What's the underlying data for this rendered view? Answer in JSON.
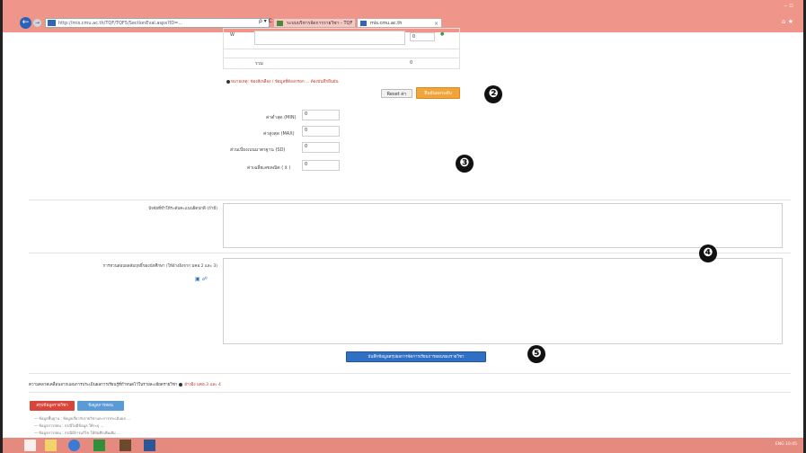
{
  "browser": {
    "url": "http://mis.cmu.ac.th/TQF/TQF5/SectionEval.aspx?ID=...",
    "tabs": [
      {
        "label": "ระบบบริหารจัดการรายวิชา - TQF",
        "active": false
      },
      {
        "label": "mis.cmu.ac.th",
        "active": true
      }
    ],
    "nav_tools": "ρ ▾ C",
    "window_controls": "– ▫",
    "window_tools": "⌂ ★"
  },
  "grade_table": {
    "row_w": {
      "grade": "W",
      "count": "0",
      "status": "●"
    },
    "total": {
      "label": "รวม",
      "count": "0"
    }
  },
  "note": "หมายเหตุ: ช่องสีเหลือง / ข้อมูลที่ต้องกรอก ... ต้องบันทึกยืนยัน",
  "buttons": {
    "reset": "Reset ค่า",
    "confirm": "ยืนยันผลระดับ",
    "save": "บันทึกข้อมูลสรุปผลการจัดการเรียนการสอนของรายวิชา",
    "tab_red": "สรุปข้อมูลรายวิชา",
    "tab_blue": "ข้อมูลการสอน"
  },
  "stats": [
    {
      "label": "ค่าต่ำสุด (MIN)",
      "value": "0"
    },
    {
      "label": "ค่าสูงสุด (MAX)",
      "value": "0"
    },
    {
      "label": "ส่วนเบี่ยงเบนมาตรฐาน (SD)",
      "value": "0"
    },
    {
      "label": "ค่าเฉลี่ยเลขคณิต ( x̄ )",
      "value": "0"
    }
  ],
  "textareas": {
    "factor_label": "ปัจจัยที่ทำให้ระดับคะแนนผิดปกติ (ถ้ามี)",
    "verify_label": "การทวนสอบผลสัมฤทธิ์ของนักศึกษา (ให้อ้างอิงจาก มคอ.2 และ 3)"
  },
  "section_title": "ความคลาดเคลื่อนจากแผนการประเมินผลการเรียนรู้ที่กำหนดไว้ในรายละเอียดรายวิชา",
  "section_hint": "อ้างอิง มคอ.3 และ 4",
  "info_lines": [
    "— ข้อมูลพื้นฐาน : ข้อมูลเกี่ยวกับรายวิชาและการประเมินผล ...",
    "— ข้อมูลการสอน : กรณีไม่มีข้อมูล ให้ระบุ ...",
    "— ข้อมูลการสอน : กรณีมีการแก้ไข ให้บันทึกเพิ่มเติม ..."
  ],
  "callouts": [
    "❷",
    "❸",
    "❹",
    "❺"
  ],
  "taskbar": {
    "clock": "ENG 10:45"
  }
}
